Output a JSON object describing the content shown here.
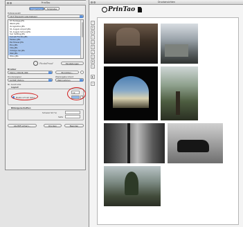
{
  "left_window": {
    "title": "PrintTao",
    "tabs": [
      {
        "label": "Allgemeines",
        "active": true
      },
      {
        "label": "Templates",
        "active": false
      }
    ],
    "section_label": "Dateiauswahl",
    "folder_select": "16 P Übersicht (alle Dateien)",
    "files": [
      {
        "name": "07 Parkage.JPG",
        "selected": false
      },
      {
        "name": "IPark1.JPG",
        "selected": false
      },
      {
        "name": "IG Agostino.JPG",
        "selected": false
      },
      {
        "name": "St. Angelo Airport.JPG",
        "selected": false
      },
      {
        "name": "St. Angelo School.JPG",
        "selected": false
      },
      {
        "name": "Sun Setting.JPG",
        "selected": false
      },
      {
        "name": "Sunset Florida.JPG",
        "selected": true
      },
      {
        "name": "Tableur.JPG",
        "selected": true
      },
      {
        "name": "Pechtower.JPG",
        "selected": true
      },
      {
        "name": "Pine.JPG",
        "selected": true
      },
      {
        "name": "Villa.JPG",
        "selected": true
      },
      {
        "name": "Vintage Car.JPG",
        "selected": true
      },
      {
        "name": "Wall.JPG",
        "selected": true
      },
      {
        "name": "Wine.JPG",
        "selected": false
      }
    ],
    "brand_label": "PhotoProof",
    "settings_button": "Einstellungen",
    "printer_label": "Drucker",
    "printer_select": "Stylus_COLOR_900",
    "printer_button": "Einrichten...",
    "paper_label": "Druckerpapier",
    "paper_select": "SCHOE_PAP.ics",
    "quality_label": "Wiedergabe Intent",
    "quality_select": "Wahrnehmen",
    "layout_label": "Nr. Ausdrucke",
    "layout_section": "Layout",
    "orientation_value": "Breite  schnell laden",
    "count_value": "12",
    "image_section": "Bildeigenschaften",
    "width_label": "Schwarz W (%)",
    "width_value": "",
    "page_label": "Seite",
    "page_value": "",
    "pdf_button": "Als PDF sichern...",
    "print_button": "Drucken",
    "apply_button": "Beenden"
  },
  "right_window": {
    "title": "Druckansichten",
    "logo_text": "PrinTao",
    "tools": [
      "hand-icon",
      "zoom-icon",
      "rotate-icon",
      "crop-icon",
      "rect-icon",
      "text-icon",
      "line-icon",
      "oval-icon",
      "move-icon",
      "scale-icon",
      "color-icon",
      "help-icon"
    ],
    "photos": [
      "dark-landscape",
      "mountain-village",
      "arch-sky",
      "olive-tree",
      "village-street",
      "vintage-car",
      "pine-landscape"
    ]
  },
  "colors": {
    "accent_blue": "#3f7ad0",
    "selection": "#a8c6ef",
    "annotation_red": "#d11c1c"
  }
}
